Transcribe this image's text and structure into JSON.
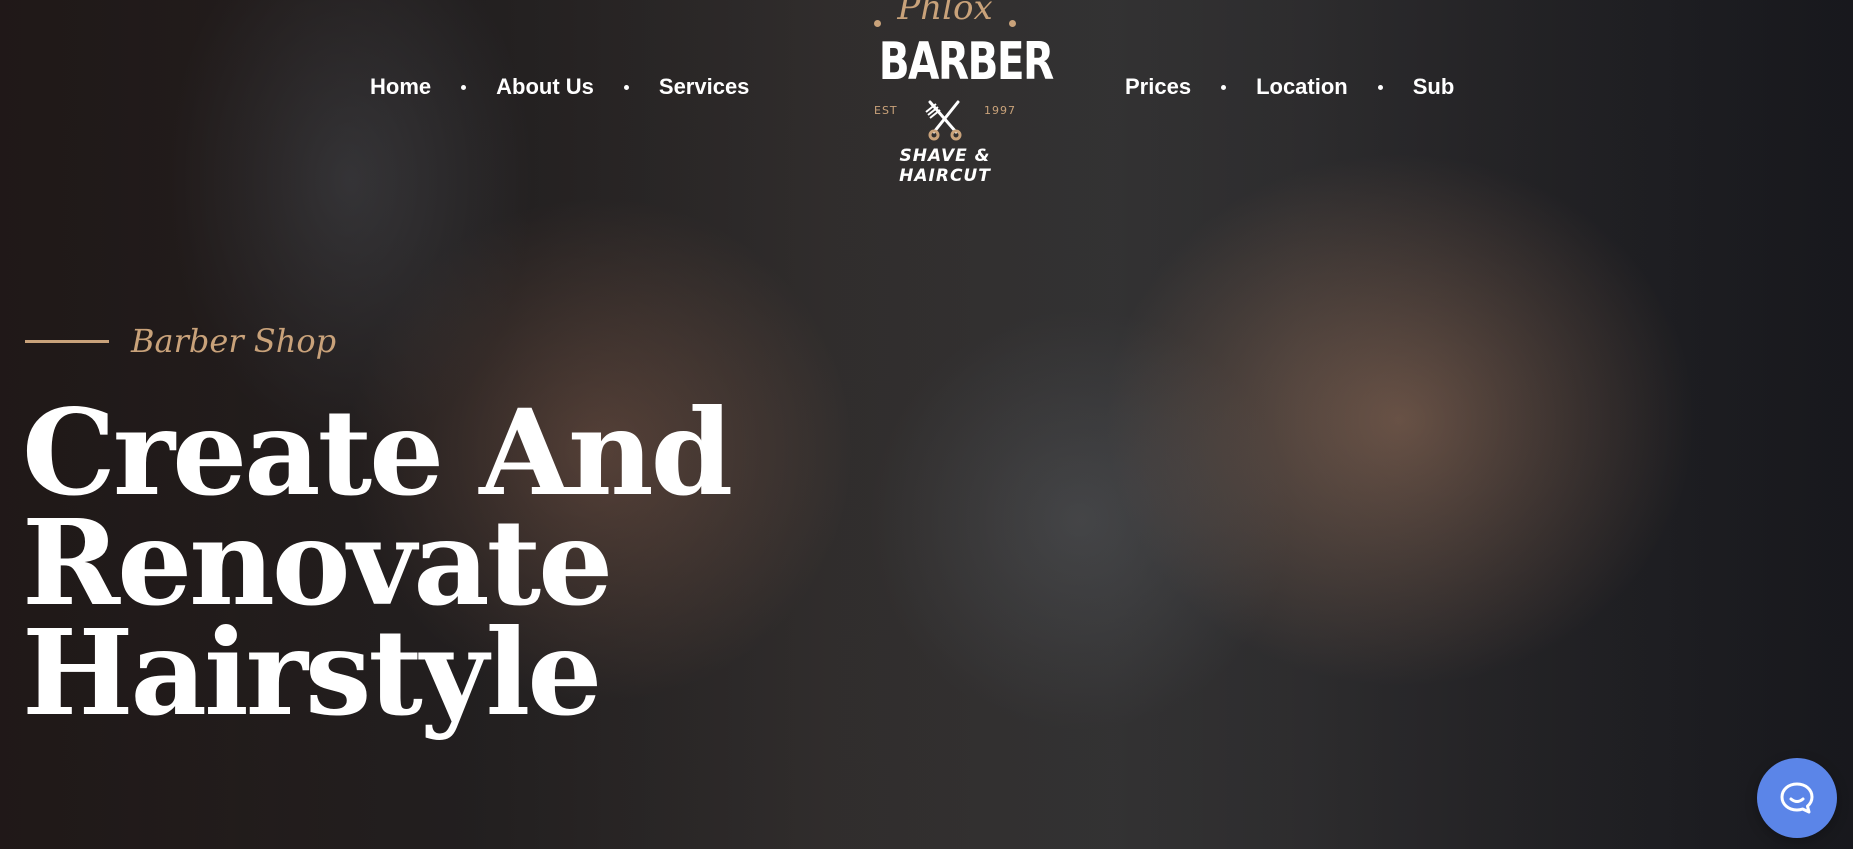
{
  "nav": {
    "left": [
      {
        "label": "Home"
      },
      {
        "label": "About Us"
      },
      {
        "label": "Services"
      }
    ],
    "right": [
      {
        "label": "Prices"
      },
      {
        "label": "Location"
      },
      {
        "label": "Sub"
      }
    ]
  },
  "logo": {
    "script": "Phlox",
    "word": "BARBER",
    "est": "EST",
    "year": "1997",
    "tagline": "SHAVE & HAIRCUT",
    "accent_color": "#c9a27a"
  },
  "hero": {
    "eyebrow": "Barber Shop",
    "headline": [
      "Create And",
      "Renovate",
      "Hairstyle"
    ],
    "accent_color": "#c9a27a"
  },
  "chat": {
    "icon": "chat-bubble-icon",
    "color": "#5b85e8"
  }
}
